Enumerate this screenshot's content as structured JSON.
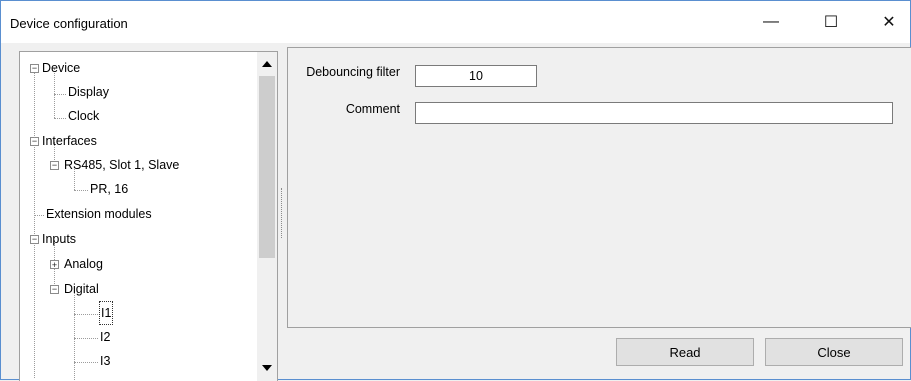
{
  "window": {
    "title": "Device configuration",
    "minimize_glyph": "—",
    "maximize_glyph": "☐",
    "close_glyph": "✕"
  },
  "tree": {
    "expanded_glyph": "−",
    "collapsed_glyph": "+",
    "nodes": [
      {
        "label": "Device",
        "expander": "expanded"
      },
      {
        "label": "Display"
      },
      {
        "label": "Clock"
      },
      {
        "label": "Interfaces",
        "expander": "expanded"
      },
      {
        "label": "RS485, Slot 1, Slave",
        "expander": "expanded"
      },
      {
        "label": "PR, 16"
      },
      {
        "label": "Extension modules"
      },
      {
        "label": "Inputs",
        "expander": "expanded"
      },
      {
        "label": "Analog",
        "expander": "collapsed"
      },
      {
        "label": "Digital",
        "expander": "expanded"
      },
      {
        "label": "I1",
        "selected": true
      },
      {
        "label": "I2"
      },
      {
        "label": "I3"
      }
    ]
  },
  "properties": {
    "debouncing_label": "Debouncing filter",
    "debouncing_value": "10",
    "comment_label": "Comment",
    "comment_value": ""
  },
  "buttons": {
    "read": "Read",
    "close": "Close"
  }
}
